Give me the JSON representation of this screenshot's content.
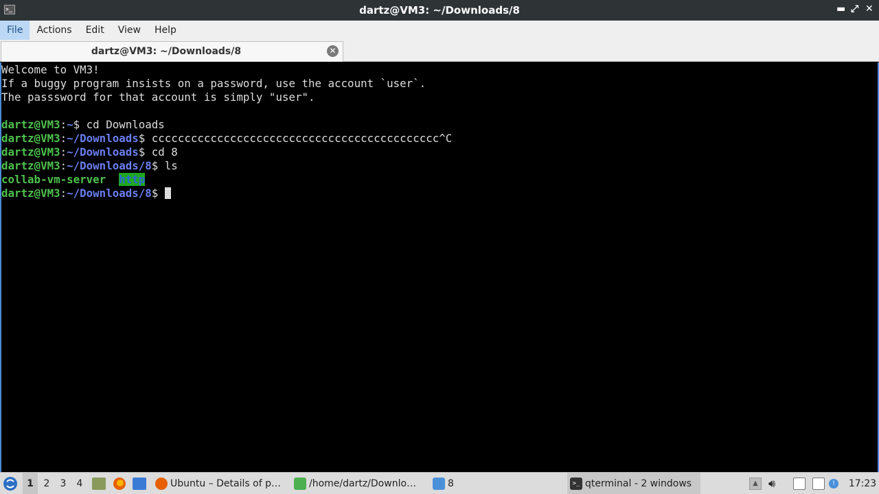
{
  "window": {
    "title": "dartz@VM3: ~/Downloads/8",
    "controls": {
      "minimize": "▬",
      "maximize": "⤢",
      "close": "✕"
    }
  },
  "menubar": {
    "items": [
      "File",
      "Actions",
      "Edit",
      "View",
      "Help"
    ],
    "active": "File"
  },
  "tab": {
    "label": "dartz@VM3: ~/Downloads/8",
    "close": "✕"
  },
  "terminal": {
    "lines": [
      {
        "segments": [
          {
            "t": "Welcome to VM3!",
            "c": "w"
          }
        ]
      },
      {
        "segments": [
          {
            "t": "If a buggy program insists on a password, use the account `user`.",
            "c": "w"
          }
        ]
      },
      {
        "segments": [
          {
            "t": "The passsword for that account is simply \"user\".",
            "c": "w"
          }
        ]
      },
      {
        "segments": []
      },
      {
        "segments": [
          {
            "t": "dartz@VM3",
            "c": "g"
          },
          {
            "t": ":",
            "c": "w"
          },
          {
            "t": "~",
            "c": "b"
          },
          {
            "t": "$ cd Downloads",
            "c": "w"
          }
        ]
      },
      {
        "segments": [
          {
            "t": "dartz@VM3",
            "c": "g"
          },
          {
            "t": ":",
            "c": "w"
          },
          {
            "t": "~/Downloads",
            "c": "b"
          },
          {
            "t": "$ cccccccccccccccccccccccccccccccccccccccccccc^C",
            "c": "w"
          }
        ]
      },
      {
        "segments": [
          {
            "t": "dartz@VM3",
            "c": "g"
          },
          {
            "t": ":",
            "c": "w"
          },
          {
            "t": "~/Downloads",
            "c": "b"
          },
          {
            "t": "$ cd 8",
            "c": "w"
          }
        ]
      },
      {
        "segments": [
          {
            "t": "dartz@VM3",
            "c": "g"
          },
          {
            "t": ":",
            "c": "w"
          },
          {
            "t": "~/Downloads/8",
            "c": "b"
          },
          {
            "t": "$ ls",
            "c": "w"
          }
        ]
      },
      {
        "segments": [
          {
            "t": "collab-vm-server",
            "c": "g"
          },
          {
            "t": "  ",
            "c": "w"
          },
          {
            "t": "http",
            "c": "hl"
          }
        ]
      },
      {
        "segments": [
          {
            "t": "dartz@VM3",
            "c": "g"
          },
          {
            "t": ":",
            "c": "w"
          },
          {
            "t": "~/Downloads/8",
            "c": "b"
          },
          {
            "t": "$ ",
            "c": "w"
          }
        ],
        "cursor": true
      }
    ]
  },
  "taskbar": {
    "desktops": [
      "1",
      "2",
      "3",
      "4"
    ],
    "active_desktop": "1",
    "quicklaunch": [
      "files-icon",
      "firefox-icon",
      "desktop-icon"
    ],
    "tasks": [
      {
        "label": "Ubuntu – Details of p…",
        "icon": "firefox-icon",
        "color": "#e66000"
      },
      {
        "label": "/home/dartz/Downlo…",
        "icon": "archive-icon",
        "color": "#4caf50"
      },
      {
        "label": "8",
        "icon": "folder-icon",
        "color": "#4a90d9"
      },
      {
        "label": "qterminal - 2 windows",
        "icon": "terminal-icon",
        "color": "#333333",
        "active": true
      }
    ],
    "tray": [
      "up-arrow-icon",
      "volume-icon",
      "clipboard-icon",
      "updates-icon",
      "network-icon"
    ],
    "clock": "17:23"
  }
}
